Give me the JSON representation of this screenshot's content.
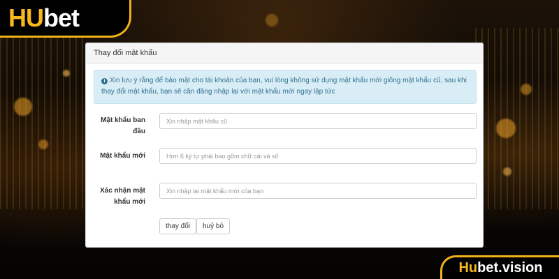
{
  "brand": {
    "logo_hu": "HU",
    "logo_bet": "bet",
    "watermark_hu": "Hu",
    "watermark_rest": "bet.vision"
  },
  "panel": {
    "title": "Thay đổi mật khẩu",
    "alert_icon": "info-circle-icon",
    "alert_text": "Xin lưu ý rằng để bảo mật cho tài khoản của bạn, vui lòng không sử dụng mật khẩu mới giống mật khẩu cũ, sau khi thay đổi mật khẩu, bạn sẽ cần đăng nhập lại với mật khẩu mới ngay lập tức"
  },
  "form": {
    "current_label": "Mật khẩu ban đầu",
    "current_placeholder": "Xin nhập mật khẩu cũ",
    "new_label": "Mật khẩu mới",
    "new_placeholder": "Hơn 6 ký tự phải bao gồm chữ cái và số",
    "confirm_label": "Xác nhận mật khẩu mới",
    "confirm_placeholder": "Xin nhập lại mật khẩu mới của bạn",
    "submit_label": "thay đổi",
    "cancel_label": "huỷ bỏ"
  },
  "colors": {
    "brand_gold": "#f6b81c",
    "alert_bg": "#d9edf7",
    "alert_text": "#31708f"
  }
}
